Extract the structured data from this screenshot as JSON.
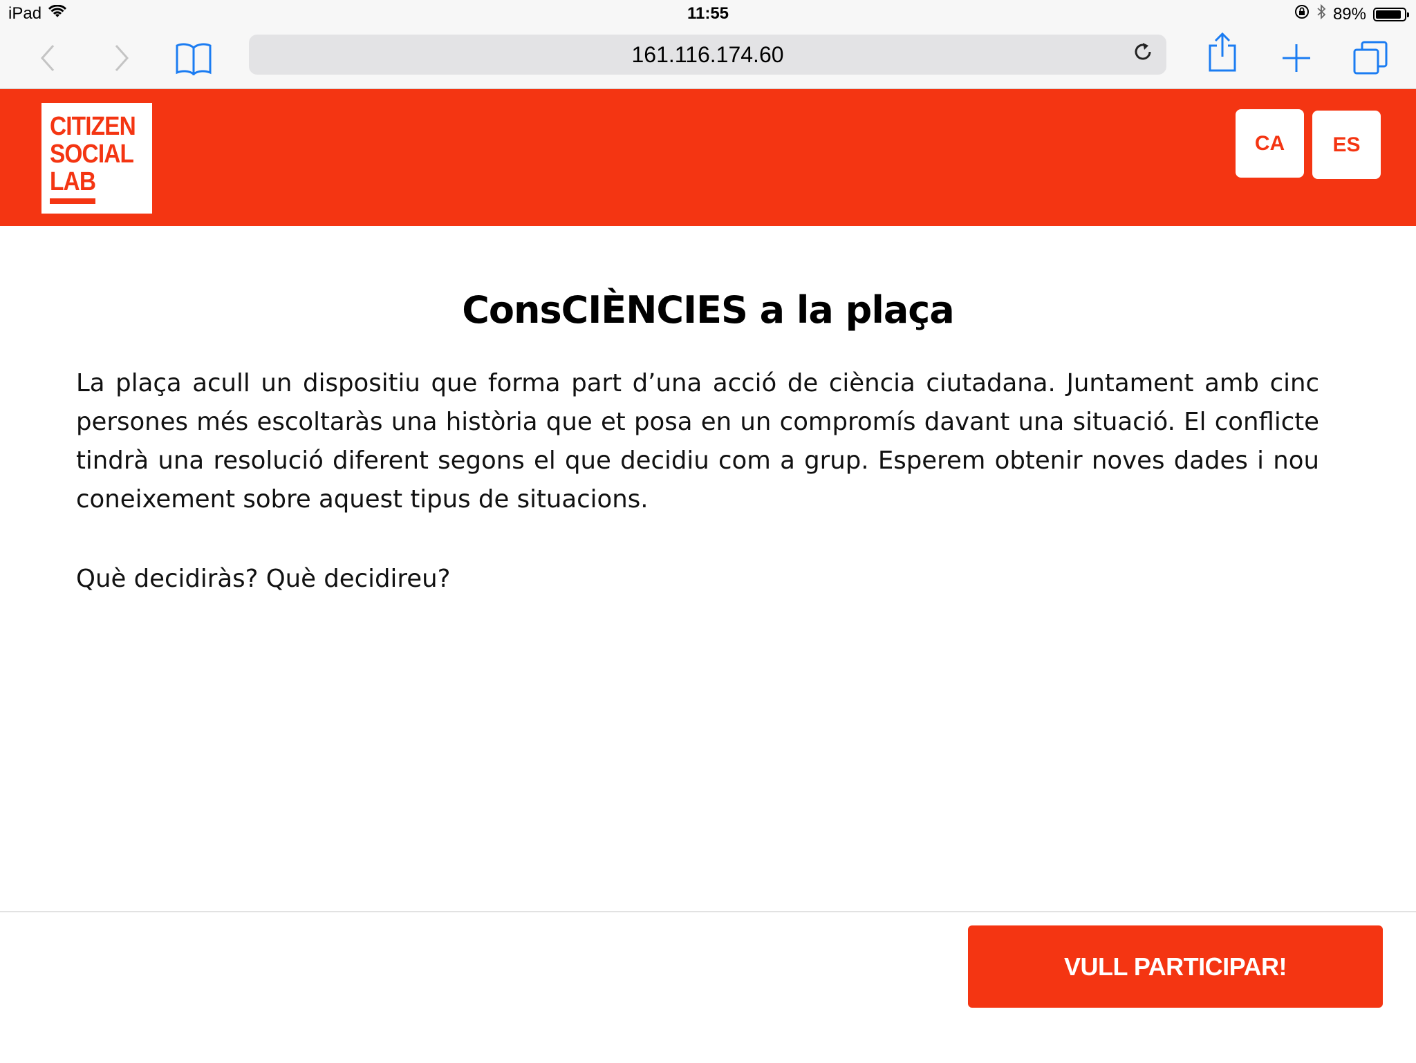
{
  "status_bar": {
    "device": "iPad",
    "time": "11:55",
    "battery_percent": "89%",
    "battery_level": 0.89,
    "icons": [
      "wifi-icon",
      "orientation-lock-icon",
      "bluetooth-icon",
      "battery-icon"
    ]
  },
  "browser": {
    "url": "161.116.174.60",
    "icons": [
      "back-icon",
      "forward-icon",
      "bookmarks-icon",
      "reload-icon",
      "share-icon",
      "new-tab-icon",
      "tabs-icon"
    ]
  },
  "header": {
    "logo_lines": [
      "CITIZEN",
      "SOCIAL",
      "LAB"
    ],
    "lang_ca": "CA",
    "lang_es": "ES"
  },
  "main": {
    "title": "ConsCIÈNCIES a la plaça",
    "intro": "La plaça acull un dispositiu que forma part d’una acció de ciència ciutadana. Juntament amb cinc persones més escoltaràs una història que et posa en un compromís davant una situació. El conflicte tindrà una resolució diferent segons el que decidiu com a grup. Esperem obtenir noves dades i nou coneixement sobre aquest tipus de situacions.",
    "question": "Què decidiràs? Què decidireu?"
  },
  "footer": {
    "cta_label": "VULL PARTICIPAR!"
  },
  "colors": {
    "brand": "#f43512",
    "ios_blue": "#1b7cf2"
  }
}
